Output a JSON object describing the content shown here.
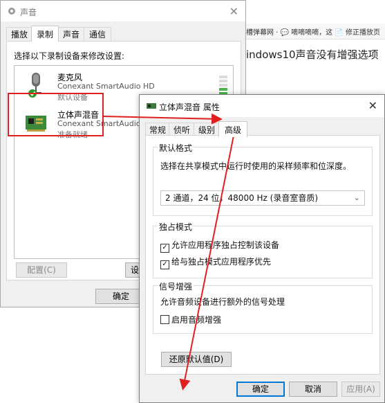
{
  "browser": {
    "tabs_text": "吐槽弹幕网 · 💬 嘀嘀嘀嘀，这  📄 修正播放页",
    "page_heading": "indows10声音没有增强选项"
  },
  "sound_dialog": {
    "title": "声音",
    "tabs": [
      {
        "label": "播放",
        "active": false
      },
      {
        "label": "录制",
        "active": true
      },
      {
        "label": "声音",
        "active": false
      },
      {
        "label": "通信",
        "active": false
      }
    ],
    "instruction": "选择以下录制设备来修改设置:",
    "devices": [
      {
        "name": "麦克风",
        "driver": "Conexant SmartAudio HD",
        "status": "默认设备",
        "icon": "microphone-icon"
      },
      {
        "name": "立体声混音",
        "driver": "Conexant SmartAudio HD",
        "status": "准备就绪",
        "icon": "sound-card-icon"
      }
    ],
    "buttons": {
      "configure": "配置(C)",
      "set_default": "设为",
      "ok": "确定"
    }
  },
  "properties_dialog": {
    "title": "立体声混音 属性",
    "tabs": [
      {
        "label": "常规",
        "active": false
      },
      {
        "label": "侦听",
        "active": false
      },
      {
        "label": "级别",
        "active": false
      },
      {
        "label": "高级",
        "active": true
      }
    ],
    "default_format": {
      "title": "默认格式",
      "description": "选择在共享模式中运行时使用的采样频率和位深度。",
      "selected": "2 通道，24 位，48000 Hz (录音室音质)"
    },
    "exclusive_mode": {
      "title": "独占模式",
      "options": [
        {
          "label": "允许应用程序独占控制该设备",
          "checked": true
        },
        {
          "label": "给与独占模式应用程序优先",
          "checked": true
        }
      ]
    },
    "signal_enhancements": {
      "title": "信号增强",
      "description": "允许音频设备进行额外的信号处理",
      "option": {
        "label": "启用音频增强",
        "checked": false
      }
    },
    "buttons": {
      "restore_defaults": "还原默认值(D)",
      "ok": "确定",
      "cancel": "取消",
      "apply": "应用(A)"
    }
  },
  "colors": {
    "annotation_red": "#e02020",
    "focus_blue": "#0078d7",
    "level_green": "#4cb84c"
  }
}
